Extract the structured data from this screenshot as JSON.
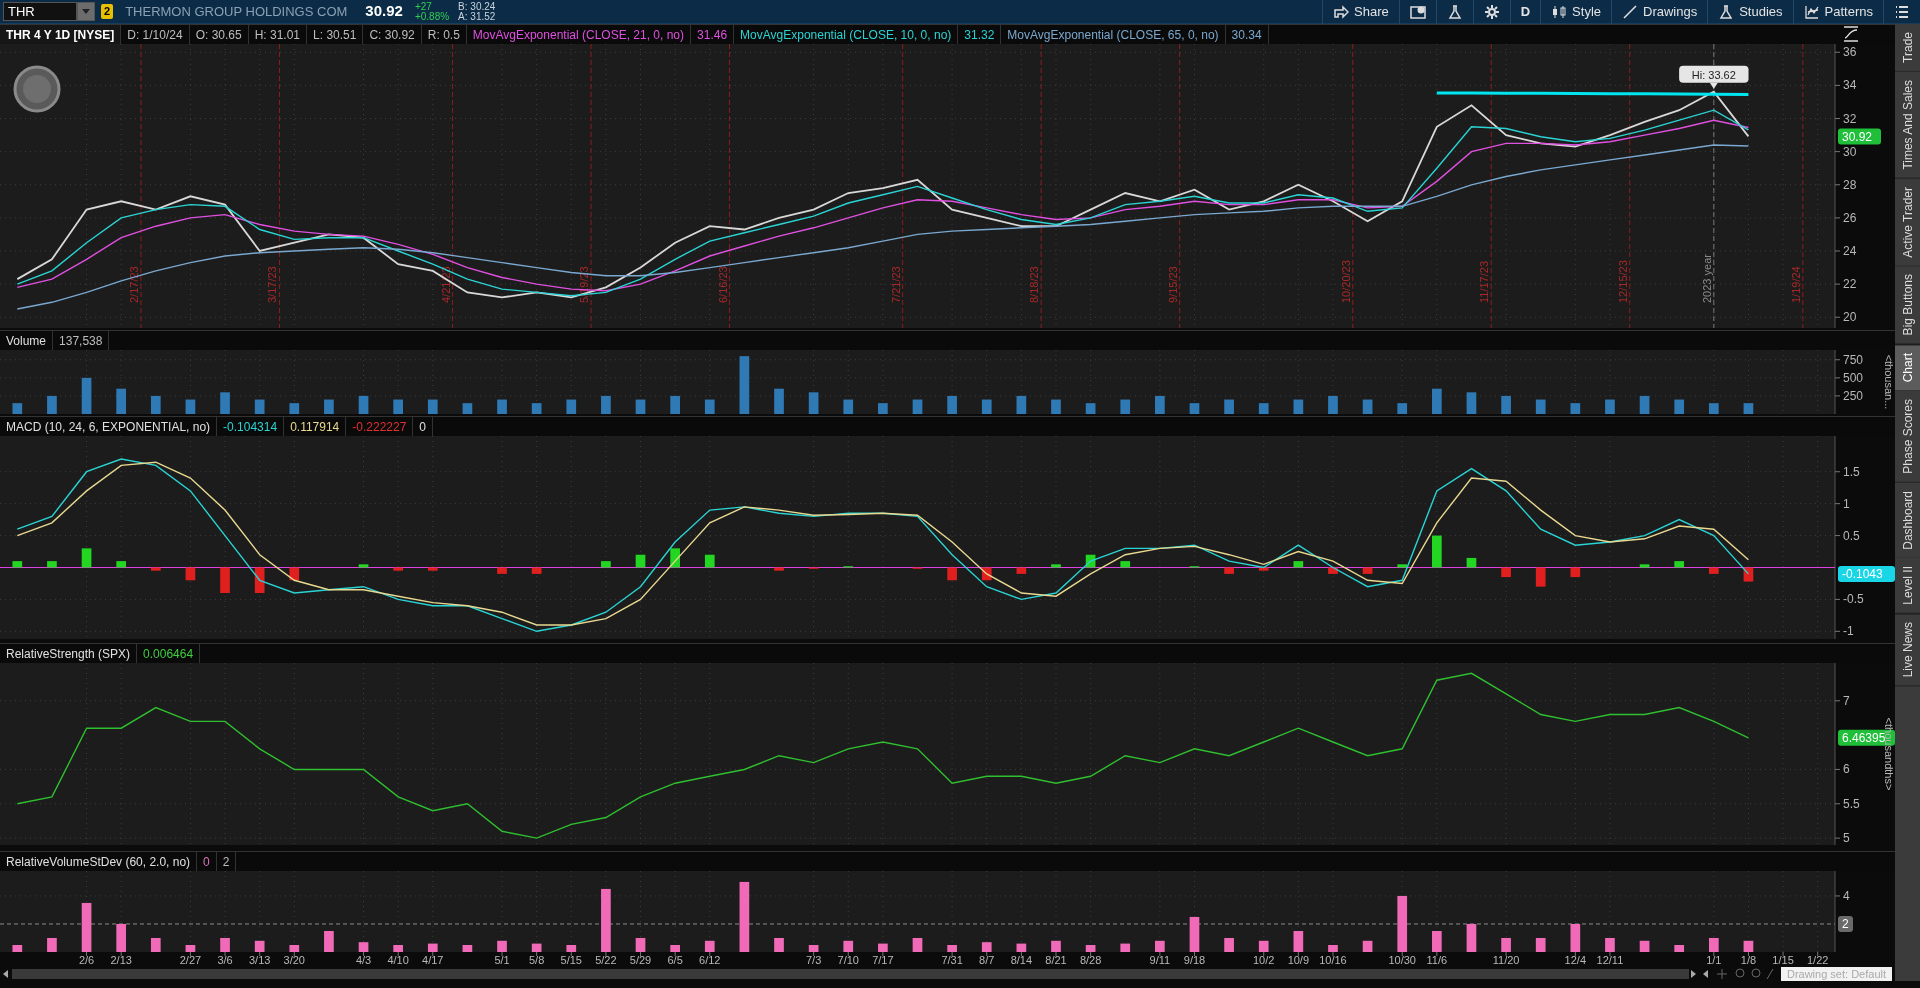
{
  "toolbar": {
    "symbol": "THR",
    "link_badge": "2",
    "company": "THERMON GROUP HOLDINGS COM",
    "last": "30.92",
    "change": "+27",
    "change_pct": "+0.88%",
    "bid": "B: 30.24",
    "ask": "A: 31.52",
    "buttons": [
      {
        "kind": "share",
        "label": "Share"
      },
      {
        "kind": "alert"
      },
      {
        "kind": "flask"
      },
      {
        "kind": "gear"
      },
      {
        "kind": "text",
        "label": "D"
      },
      {
        "kind": "style",
        "label": "Style"
      },
      {
        "kind": "drawings",
        "label": "Drawings"
      },
      {
        "kind": "studies",
        "label": "Studies"
      },
      {
        "kind": "patterns",
        "label": "Patterns"
      },
      {
        "kind": "menu"
      }
    ]
  },
  "panels": [
    {
      "kind": "price",
      "header": [
        {
          "kind": "title",
          "text": "THR 4 Y 1D [NYSE]",
          "color": "#ffffff"
        },
        {
          "text": "D: 1/10/24",
          "color": "#bdbdbd"
        },
        {
          "text": "O: 30.65",
          "color": "#bdbdbd"
        },
        {
          "text": "H: 31.01",
          "color": "#bdbdbd"
        },
        {
          "text": "L: 30.51",
          "color": "#bdbdbd"
        },
        {
          "text": "C: 30.92",
          "color": "#bdbdbd"
        },
        {
          "text": "R: 0.5",
          "color": "#bdbdbd"
        },
        {
          "text": "MovAvgExponential (CLOSE, 21, 0, no)",
          "color": "#e050e0"
        },
        {
          "text": "31.46",
          "color": "#e050e0"
        },
        {
          "text": "MovAvgExponential (CLOSE, 10, 0, no)",
          "color": "#2ad4d4"
        },
        {
          "text": "31.32",
          "color": "#2ad4d4"
        },
        {
          "text": "MovAvgExponential (CLOSE, 65, 0, no)",
          "color": "#7aa8d0"
        },
        {
          "text": "30.34",
          "color": "#7aa8d0"
        }
      ],
      "date_markers": [
        {
          "kind": "expiry",
          "label": "2/17/23"
        },
        {
          "kind": "expiry",
          "label": "3/17/23"
        },
        {
          "kind": "expiry",
          "label": "4/21/23"
        },
        {
          "kind": "expiry",
          "label": "5/19/23"
        },
        {
          "kind": "expiry",
          "label": "6/16/23"
        },
        {
          "kind": "expiry",
          "label": "7/21/23"
        },
        {
          "kind": "expiry",
          "label": "8/18/23"
        },
        {
          "kind": "expiry",
          "label": "9/15/23"
        },
        {
          "kind": "expiry",
          "label": "10/20/23"
        },
        {
          "kind": "expiry",
          "label": "11/17/23"
        },
        {
          "kind": "expiry",
          "label": "12/15/23"
        },
        {
          "kind": "expiry",
          "label": "1/19/24"
        },
        {
          "kind": "year",
          "label": "2023 year"
        }
      ],
      "chart_data": {
        "type": "line",
        "grid": true,
        "ylim": [
          19.35,
          36.5
        ],
        "yticks": [
          20,
          22,
          24,
          26,
          28,
          30,
          32,
          34,
          36
        ],
        "series": [
          {
            "color": "#d8d8d8",
            "values": [
              22.3,
              23.5,
              26.5,
              27,
              26.5,
              27.3,
              26.8,
              24,
              24.5,
              25,
              24.8,
              23.2,
              22.8,
              21.5,
              21.2,
              21.5,
              21.2,
              21.8,
              23,
              24.5,
              25.5,
              25.3,
              26,
              26.5,
              27.5,
              27.8,
              28.3,
              26.5,
              26,
              25.5,
              25.5,
              26.5,
              27.5,
              27,
              27.7,
              26.5,
              27,
              28,
              27,
              25.8,
              27,
              31.5,
              32.8,
              31,
              30.5,
              30.3,
              31,
              31.8,
              32.5,
              33.62,
              30.92,
              null,
              null
            ]
          },
          {
            "color": "#e050e0",
            "values": [
              21.8,
              22.3,
              23.5,
              24.8,
              25.5,
              26,
              26.2,
              25.6,
              25.2,
              25,
              24.9,
              24.4,
              23.8,
              23,
              22.4,
              22,
              21.7,
              21.6,
              22,
              22.8,
              23.7,
              24.3,
              24.9,
              25.4,
              26,
              26.6,
              27.1,
              27,
              26.6,
              26.2,
              25.9,
              26,
              26.5,
              26.7,
              27,
              26.8,
              26.8,
              27.1,
              27.1,
              26.6,
              26.7,
              28.2,
              30,
              30.5,
              30.5,
              30.4,
              30.6,
              31,
              31.4,
              31.9,
              31.46,
              null,
              null
            ]
          },
          {
            "color": "#2ad4d4",
            "values": [
              22,
              22.8,
              24.5,
              26,
              26.5,
              26.8,
              26.7,
              25.3,
              24.7,
              24.8,
              24.8,
              24,
              23.2,
              22.3,
              21.7,
              21.5,
              21.3,
              21.5,
              22.3,
              23.5,
              24.6,
              25.1,
              25.6,
              26.1,
              26.9,
              27.4,
              27.9,
              27.2,
              26.5,
              25.9,
              25.6,
              26,
              26.8,
              27,
              27.3,
              26.9,
              26.9,
              27.4,
              27.2,
              26.4,
              26.6,
              29,
              31.5,
              31.4,
              30.9,
              30.6,
              30.8,
              31.3,
              31.9,
              32.5,
              31.32,
              null,
              null
            ]
          },
          {
            "color": "#7aa8d0",
            "values": [
              20.5,
              20.9,
              21.5,
              22.2,
              22.8,
              23.3,
              23.7,
              23.9,
              24,
              24.1,
              24.2,
              24.1,
              23.9,
              23.6,
              23.3,
              23,
              22.7,
              22.5,
              22.5,
              22.7,
              23,
              23.3,
              23.6,
              23.9,
              24.2,
              24.6,
              25,
              25.2,
              25.3,
              25.4,
              25.5,
              25.6,
              25.8,
              26,
              26.2,
              26.3,
              26.4,
              26.6,
              26.7,
              26.7,
              26.7,
              27.3,
              28,
              28.5,
              28.9,
              29.2,
              29.5,
              29.8,
              30.1,
              30.4,
              30.34,
              null,
              null
            ]
          },
          {
            "color": "#00e5f0",
            "values": [
              null,
              null,
              null,
              null,
              null,
              null,
              null,
              null,
              null,
              null,
              null,
              null,
              null,
              null,
              null,
              null,
              null,
              null,
              null,
              null,
              null,
              null,
              null,
              null,
              null,
              null,
              null,
              null,
              null,
              null,
              null,
              null,
              null,
              null,
              null,
              null,
              null,
              null,
              null,
              null,
              null,
              33.55,
              33.54,
              33.53,
              33.52,
              33.51,
              33.5,
              33.49,
              33.48,
              33.47,
              33.45,
              null,
              null
            ]
          }
        ],
        "annotations": [
          {
            "y": 33.62,
            "text": "Hi: 33.62"
          },
          "30.92"
        ]
      }
    },
    {
      "kind": "volume",
      "header": [
        {
          "text": "Volume",
          "color": "#e0e0e0"
        },
        {
          "text": "137,538",
          "color": "#bdbdbd"
        }
      ],
      "axis_label": "<thousan...",
      "chart_data": {
        "type": "bar",
        "grid": true,
        "ylim": [
          0,
          885
        ],
        "yticks": [
          250,
          500,
          750
        ],
        "series": [
          {
            "color": "#2f79b5",
            "values": [
              150,
              250,
              500,
              350,
              250,
              200,
              300,
              200,
              150,
              200,
              250,
              200,
              200,
              150,
              200,
              150,
              200,
              250,
              200,
              250,
              200,
              800,
              350,
              300,
              200,
              150,
              200,
              250,
              200,
              250,
              200,
              150,
              200,
              250,
              150,
              200,
              150,
              200,
              250,
              200,
              150,
              350,
              300,
              250,
              200,
              150,
              200,
              250,
              200,
              150,
              150,
              null,
              null
            ]
          }
        ]
      }
    },
    {
      "kind": "macd",
      "header": [
        {
          "text": "MACD (10, 24, 6, EXPONENTIAL, no)",
          "color": "#e0e0e0"
        },
        {
          "text": "-0.104314",
          "color": "#2ad4d4"
        },
        {
          "text": "0.117914",
          "color": "#e8d890"
        },
        {
          "text": "-0.222227",
          "color": "#e03030"
        },
        {
          "text": "0"
        }
      ],
      "chart_data": {
        "type": "line",
        "grid": true,
        "ylim": [
          -1.12,
          2.06
        ],
        "yticks": [
          -1,
          -0.5,
          0.5,
          1,
          1.5
        ],
        "series": [
          {
            "color": "#2ad4d4",
            "values": [
              0.6,
              0.8,
              1.5,
              1.7,
              1.6,
              1.2,
              0.5,
              -0.2,
              -0.4,
              -0.35,
              -0.3,
              -0.5,
              -0.6,
              -0.6,
              -0.8,
              -1,
              -0.9,
              -0.7,
              -0.3,
              0.4,
              0.9,
              0.95,
              0.85,
              0.8,
              0.85,
              0.85,
              0.8,
              0.2,
              -0.3,
              -0.5,
              -0.4,
              0.1,
              0.3,
              0.3,
              0.35,
              0.1,
              0,
              0.35,
              0,
              -0.3,
              -0.2,
              1.2,
              1.55,
              1.2,
              0.6,
              0.35,
              0.4,
              0.5,
              0.75,
              0.5,
              -0.1,
              null,
              null
            ]
          },
          {
            "color": "#e8d890",
            "values": [
              0.5,
              0.7,
              1.2,
              1.6,
              1.65,
              1.4,
              0.9,
              0.2,
              -0.2,
              -0.35,
              -0.35,
              -0.45,
              -0.55,
              -0.6,
              -0.7,
              -0.9,
              -0.9,
              -0.8,
              -0.5,
              0.1,
              0.7,
              0.95,
              0.9,
              0.82,
              0.83,
              0.85,
              0.82,
              0.4,
              -0.1,
              -0.4,
              -0.45,
              -0.1,
              0.2,
              0.3,
              0.33,
              0.2,
              0.05,
              0.25,
              0.1,
              -0.2,
              -0.25,
              0.7,
              1.4,
              1.35,
              0.9,
              0.5,
              0.4,
              0.45,
              0.65,
              0.6,
              0.12,
              null,
              null
            ]
          },
          {
            "type": "bar",
            "color": "#22d622",
            "values": [
              0.1,
              0.1,
              0.3,
              0.1,
              null,
              null,
              null,
              null,
              null,
              null,
              0.05,
              null,
              null,
              null,
              null,
              null,
              null,
              0.1,
              0.2,
              0.3,
              0.2,
              null,
              null,
              null,
              0.02,
              null,
              null,
              null,
              null,
              null,
              0.05,
              0.2,
              0.1,
              null,
              0.02,
              null,
              null,
              0.1,
              null,
              null,
              0.05,
              0.5,
              0.15,
              null,
              null,
              null,
              null,
              0.05,
              0.1,
              null,
              null,
              null,
              null
            ]
          },
          {
            "type": "bar",
            "color": "#e01f1f",
            "values": [
              null,
              null,
              null,
              null,
              -0.05,
              -0.2,
              -0.4,
              -0.4,
              -0.2,
              null,
              null,
              -0.05,
              -0.05,
              null,
              -0.1,
              -0.1,
              null,
              null,
              null,
              null,
              null,
              null,
              -0.05,
              -0.02,
              null,
              null,
              -0.02,
              -0.2,
              -0.2,
              -0.1,
              null,
              null,
              null,
              null,
              null,
              -0.1,
              -0.05,
              null,
              -0.1,
              -0.1,
              null,
              null,
              null,
              -0.15,
              -0.3,
              -0.15,
              null,
              null,
              null,
              -0.1,
              -0.22,
              null,
              null
            ]
          }
        ],
        "ref_lines": [
          {
            "axis": "y",
            "value": 0
          }
        ],
        "annotations": [
          "-0.1043"
        ]
      }
    },
    {
      "kind": "rs",
      "header": [
        {
          "text": "RelativeStrength (SPX)",
          "color": "#e0e0e0"
        },
        {
          "text": "0.006464",
          "color": "#3fcf3f"
        }
      ],
      "axis_label": "<thousandths>",
      "chart_data": {
        "type": "line",
        "grid": true,
        "ylim": [
          4.9,
          7.55
        ],
        "yticks": [
          5,
          5.5,
          6,
          7
        ],
        "series": [
          {
            "color": "#2fbf2f",
            "values": [
              5.5,
              5.6,
              6.6,
              6.6,
              6.9,
              6.7,
              6.7,
              6.3,
              6.0,
              6.0,
              6.0,
              5.6,
              5.4,
              5.5,
              5.1,
              5.0,
              5.2,
              5.3,
              5.6,
              5.8,
              5.9,
              6.0,
              6.2,
              6.1,
              6.3,
              6.4,
              6.3,
              5.8,
              5.9,
              5.9,
              5.8,
              5.9,
              6.2,
              6.1,
              6.3,
              6.2,
              6.4,
              6.6,
              6.4,
              6.2,
              6.3,
              7.3,
              7.4,
              7.1,
              6.8,
              6.7,
              6.8,
              6.8,
              6.9,
              6.7,
              6.46,
              null,
              null
            ]
          }
        ],
        "annotations": [
          "6.46395"
        ]
      }
    },
    {
      "kind": "relvol",
      "header": [
        {
          "text": "RelativeVolumeStDev (60, 2.0, no)",
          "color": "#e0e0e0"
        },
        {
          "text": "0",
          "color": "#e070c0"
        },
        {
          "text": "2",
          "color": "#bdbdbd"
        }
      ],
      "chart_data": {
        "type": "bar",
        "grid": true,
        "ylim": [
          0,
          5.78
        ],
        "yticks": [
          4
        ],
        "categories": [
          null,
          null,
          "2/6",
          "2/13",
          null,
          "2/27",
          "3/6",
          "3/13",
          "3/20",
          null,
          "4/3",
          "4/10",
          "4/17",
          null,
          "5/1",
          "5/8",
          "5/15",
          "5/22",
          "5/29",
          "6/5",
          "6/12",
          null,
          null,
          "7/3",
          "7/10",
          "7/17",
          null,
          "7/31",
          "8/7",
          "8/14",
          "8/21",
          "8/28",
          null,
          "9/11",
          "9/18",
          null,
          "10/2",
          "10/9",
          "10/16",
          null,
          "10/30",
          "11/6",
          null,
          "11/20",
          null,
          "12/4",
          "12/11",
          null,
          null,
          "1/1",
          "1/8",
          "1/15",
          "1/22"
        ],
        "series": [
          {
            "color": "#f06ab8",
            "values": [
              0.5,
              1,
              3.5,
              2,
              1,
              0.5,
              1,
              0.8,
              0.5,
              1.5,
              0.7,
              0.5,
              0.6,
              0.5,
              0.8,
              0.6,
              0.5,
              4.5,
              1,
              0.5,
              0.8,
              5,
              1,
              0.5,
              0.8,
              0.6,
              1,
              0.5,
              0.7,
              0.6,
              0.8,
              0.5,
              0.6,
              0.8,
              2.5,
              1,
              0.8,
              1.5,
              0.5,
              0.8,
              4,
              1.5,
              2,
              1,
              1,
              2,
              1,
              0.8,
              0.5,
              1,
              0.8,
              null,
              null
            ]
          }
        ],
        "ref_lines": [
          {
            "axis": "y",
            "value": 2,
            "label": "2"
          }
        ]
      }
    }
  ],
  "sidebar": {
    "tabs": [
      {
        "label": "Trade",
        "selected": false
      },
      {
        "label": "Times And Sales",
        "selected": false
      },
      {
        "label": "Active Trader",
        "selected": false
      },
      {
        "label": "Big Buttons",
        "selected": false
      },
      {
        "label": "Chart",
        "selected": true
      },
      {
        "label": "Phase Scores",
        "selected": false
      },
      {
        "label": "Dashboard",
        "selected": false
      },
      {
        "label": "Level II",
        "selected": false
      },
      {
        "label": "Live News",
        "selected": false
      }
    ]
  },
  "footer": {
    "drawing_set": "Drawing set: Default"
  }
}
